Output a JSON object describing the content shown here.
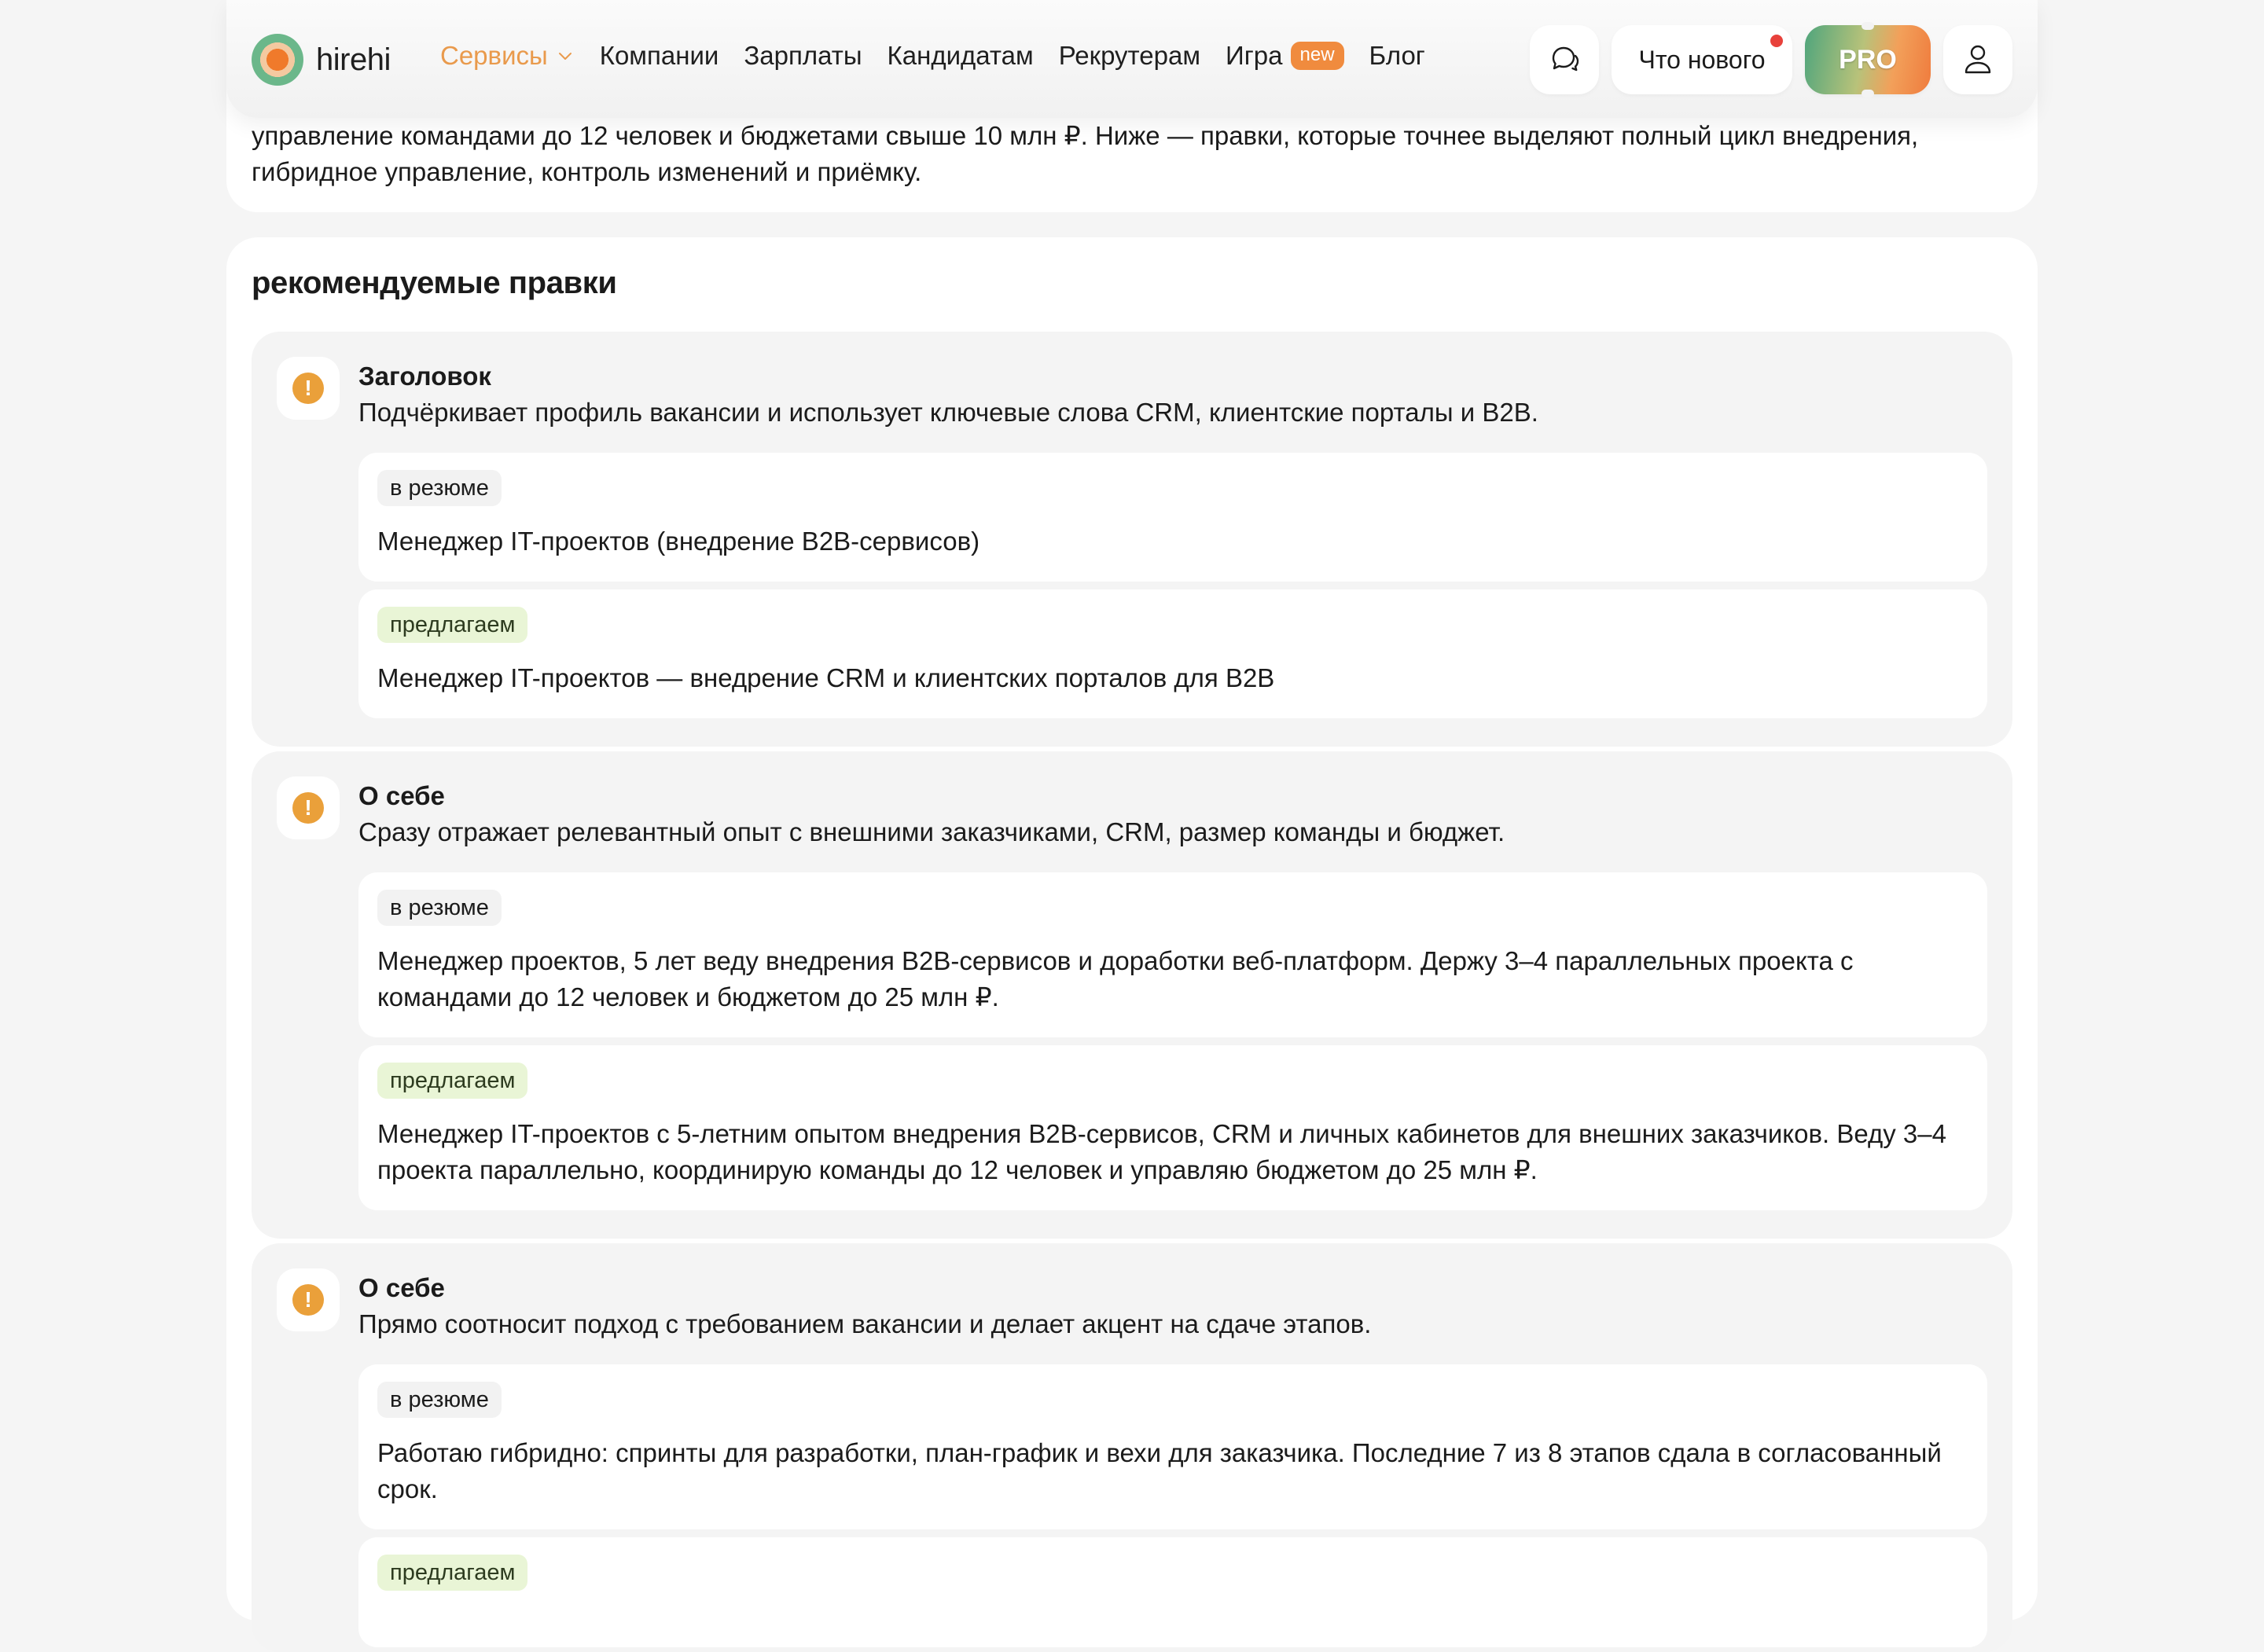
{
  "intro": {
    "text_line1": "управление командами до 12 человек и бюджетами свыше 10 млн ₽. Ниже — правки, которые точнее выделяют полный цикл внедрения,",
    "text_line2": "гибридное управление, контроль изменений и приёмку."
  },
  "header": {
    "logo_text": "hirehi",
    "nav": {
      "services": "Сервисы",
      "companies": "Компании",
      "salaries": "Зарплаты",
      "candidates": "Кандидатам",
      "recruiters": "Рекрутерам",
      "game": "Игра",
      "game_badge": "new",
      "blog": "Блог"
    },
    "whats_new": "Что нового",
    "pro": "PRO",
    "icons": [
      "chat-icon",
      "user-icon",
      "chevron-down-icon"
    ]
  },
  "main": {
    "title": "рекомендуемые правки",
    "edits": [
      {
        "title": "Заголовок",
        "desc": "Подчёркивает профиль вакансии и использует ключевые слова CRM, клиентские порталы и B2B.",
        "current_tag": "в резюме",
        "current_text": "Менеджер IT-проектов (внедрение B2B-сервисов)",
        "suggest_tag": "предлагаем",
        "suggest_text": "Менеджер IT-проектов — внедрение CRM и клиентских порталов для B2B"
      },
      {
        "title": "О себе",
        "desc": "Сразу отражает релевантный опыт с внешними заказчиками, CRM, размер команды и бюджет.",
        "current_tag": "в резюме",
        "current_text": "Менеджер проектов, 5 лет веду внедрения B2B-сервисов и доработки веб-платформ. Держу 3–4 параллельных проекта с командами до 12 человек и бюджетом до 25 млн ₽.",
        "suggest_tag": "предлагаем",
        "suggest_text": "Менеджер IT-проектов с 5-летним опытом внедрения B2B-сервисов, CRM и личных кабинетов для внешних заказчиков. Веду 3–4 проекта параллельно, координирую команды до 12 человек и управляю бюджетом до 25 млн ₽."
      },
      {
        "title": "О себе",
        "desc": "Прямо соотносит подход с требованием вакансии и делает акцент на сдаче этапов.",
        "current_tag": "в резюме",
        "current_text": "Работаю гибридно: спринты для разработки, план-график и вехи для заказчика. Последние 7 из 8 этапов сдала в согласованный срок.",
        "suggest_tag": "предлагаем",
        "suggest_text": ""
      }
    ]
  },
  "colors": {
    "accent_orange": "#eaa03a",
    "nav_active": "#e99a4c",
    "badge_new": "#f08b3e",
    "notify_dot": "#e8413b",
    "suggest_tag_bg": "#e9f5d6"
  }
}
